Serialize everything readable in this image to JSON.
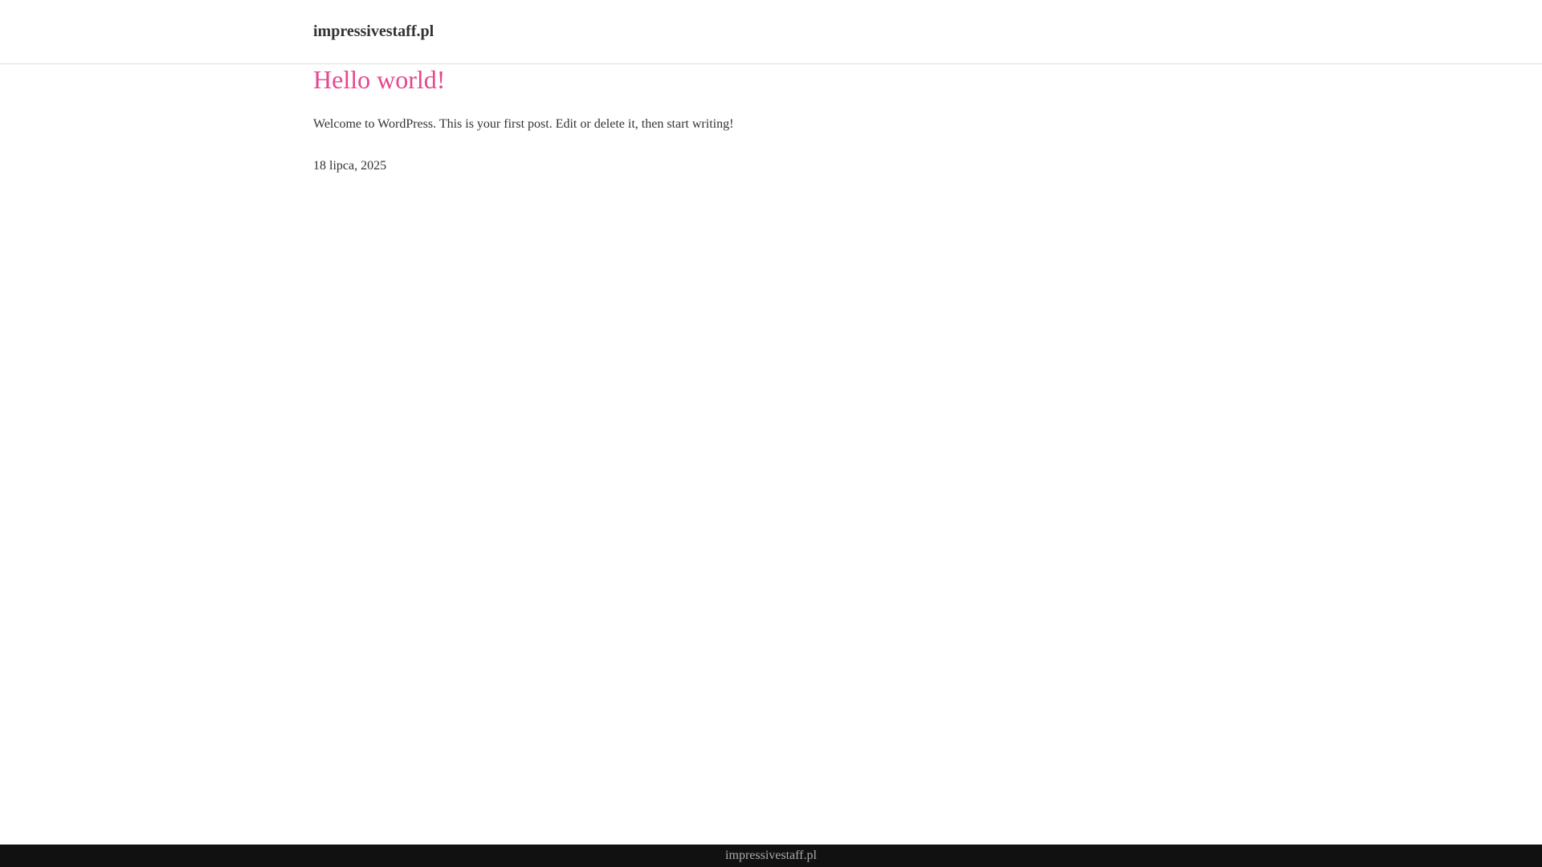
{
  "header": {
    "site_title": "impressivestaff.pl"
  },
  "post": {
    "title": "Hello world!",
    "excerpt": "Welcome to WordPress. This is your first post. Edit or delete it, then start writing!",
    "date": "18 lipca, 2025"
  },
  "footer": {
    "text": "impressivestaff.pl"
  },
  "colors": {
    "accent": "#e8468d",
    "text": "#333333",
    "footer_bg": "#111111",
    "footer_text": "#aaaaaa",
    "header_border": "#dddddd"
  }
}
